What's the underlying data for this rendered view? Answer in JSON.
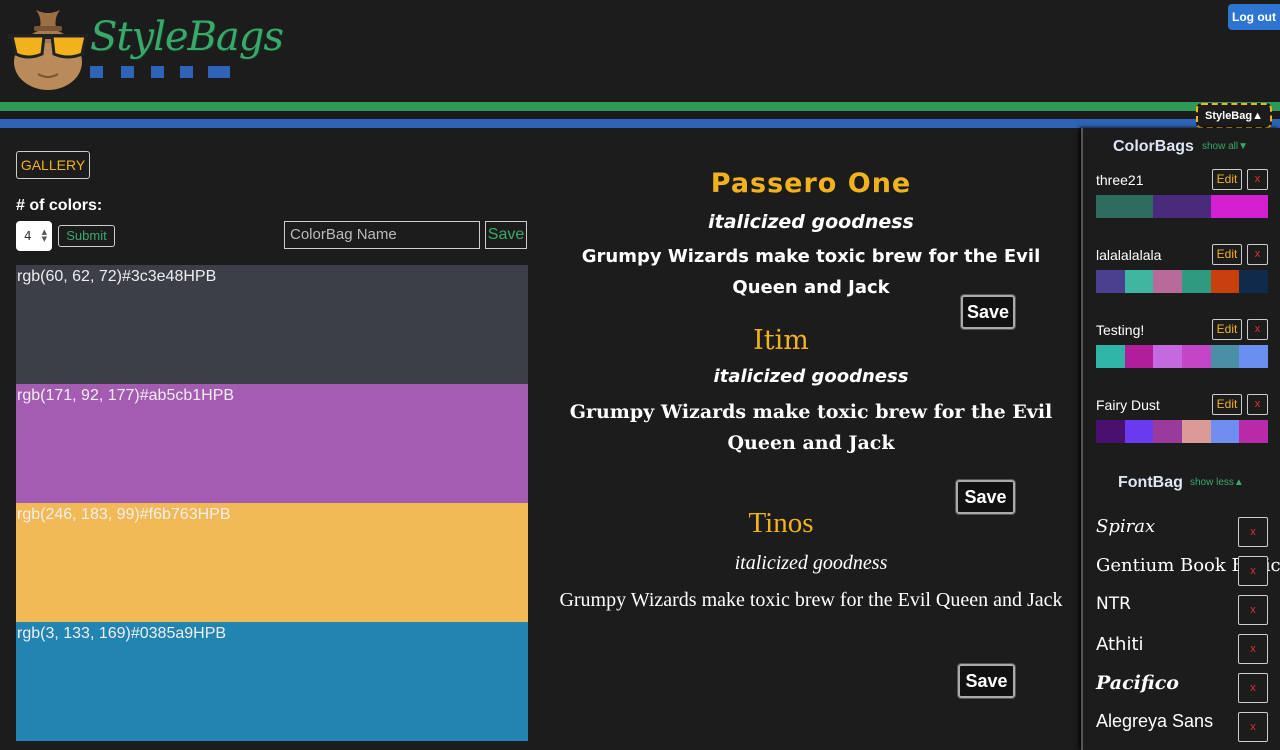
{
  "header": {
    "logo_text": "StyleBags",
    "logout_label": "Log out",
    "stylebag_toggle": "StyleBag▲",
    "colors": {
      "green": "#2f9a55",
      "blue": "#2f63b8",
      "accent": "#f2b21d"
    }
  },
  "editor": {
    "gallery_label": "GALLERY",
    "num_colors_label": "# of colors:",
    "num_colors_value": "4",
    "submit_label": "Submit",
    "name_placeholder": "ColorBag Name",
    "save_label": "Save",
    "swatches": [
      {
        "label": "rgb(60, 62, 72)#3c3e48HPB",
        "color": "#3c3e48"
      },
      {
        "label": "rgb(171, 92, 177)#ab5cb1HPB",
        "color": "#a35cb1"
      },
      {
        "label": "rgb(246, 183, 99)#f6b763HPB",
        "color": "#f2b957"
      },
      {
        "label": "rgb(3, 133, 169)#0385a9HPB",
        "color": "#2284b0"
      }
    ]
  },
  "fonts_preview": [
    {
      "name": "Passero One",
      "italic": "italicized goodness",
      "pangram": "Grumpy Wizards make toxic brew for the Evil Queen and Jack",
      "save": "Save"
    },
    {
      "name": "Itim",
      "italic": "italicized goodness",
      "pangram": "Grumpy Wizards make toxic brew for the Evil Queen and Jack",
      "save": "Save"
    },
    {
      "name": "Tinos",
      "italic": "italicized goodness",
      "pangram": "Grumpy Wizards make toxic brew for the Evil Queen and Jack",
      "save": "Save"
    }
  ],
  "sidebar": {
    "colorbags_title": "ColorBags",
    "colorbags_toggle": "show all▼",
    "edit_label": "Edit",
    "delete_label": "x",
    "colorbags": [
      {
        "name": "three21",
        "colors": [
          "#2e6b5e",
          "#4a2a7a",
          "#d41fd0"
        ]
      },
      {
        "name": "lalalalalala",
        "colors": [
          "#4b3f8f",
          "#3fb6a0",
          "#b86a9a",
          "#2f9a80",
          "#c9400e",
          "#0f2a4a"
        ]
      },
      {
        "name": "Testing!",
        "colors": [
          "#2fb6a8",
          "#b01e9a",
          "#c46ae0",
          "#c446c6",
          "#4a8fa6",
          "#6a8ff0"
        ]
      },
      {
        "name": "Fairy Dust",
        "colors": [
          "#4a1070",
          "#6a3af0",
          "#9a3a9a",
          "#d99a98",
          "#6f8ef0",
          "#b82aa8"
        ]
      }
    ],
    "fontbag_title": "FontBag",
    "fontbag_toggle": "show less▲",
    "fonts": [
      "Spirax",
      "Gentium Book Basic",
      "NTR",
      "Athiti",
      "Pacifico",
      "Alegreya Sans"
    ]
  }
}
